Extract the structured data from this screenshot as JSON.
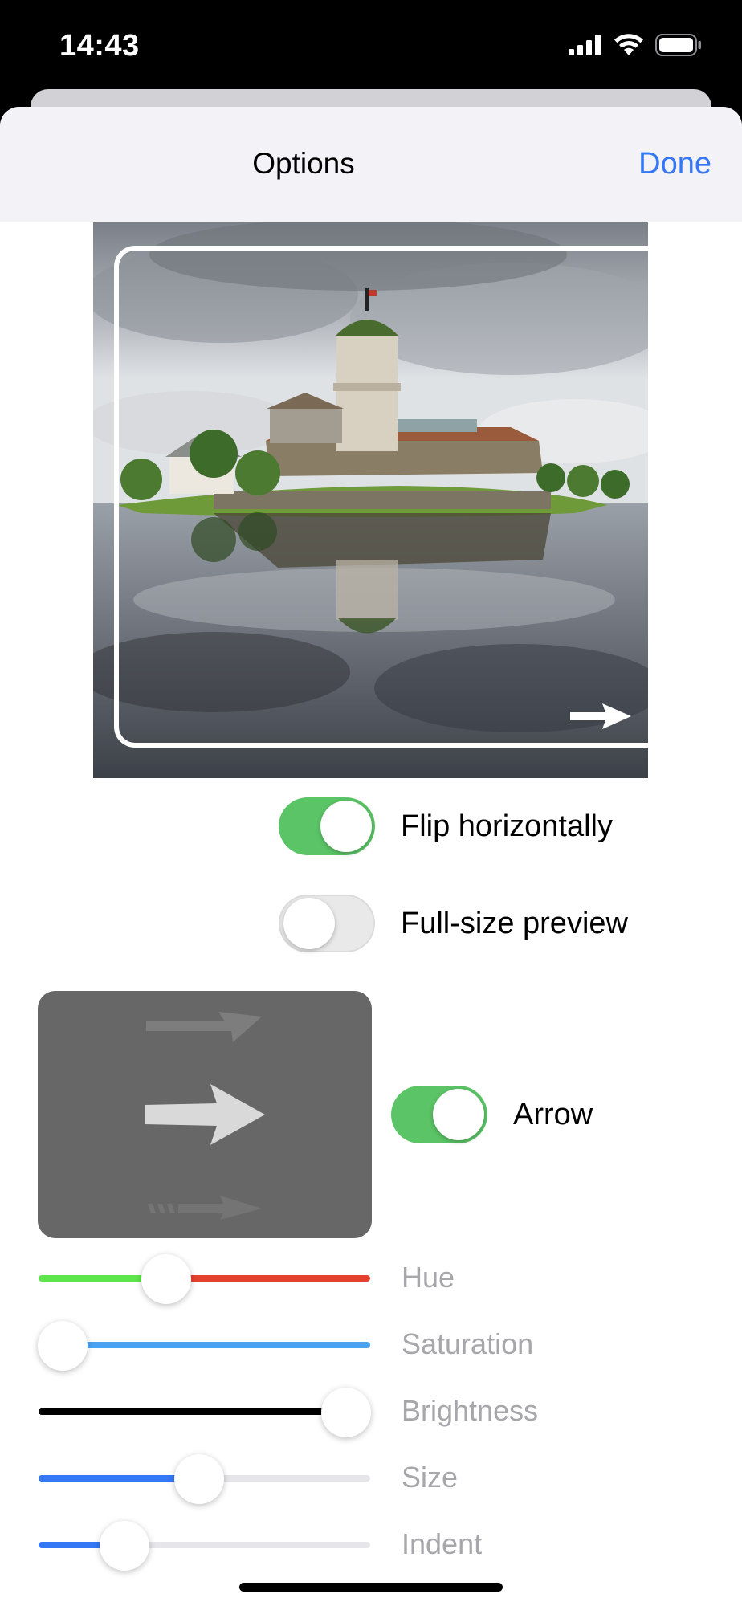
{
  "status": {
    "time": "14:43"
  },
  "nav": {
    "title": "Options",
    "done": "Done"
  },
  "toggles": {
    "flip": {
      "label": "Flip horizontally",
      "on": true
    },
    "fullsize": {
      "label": "Full-size preview",
      "on": false
    },
    "arrow": {
      "label": "Arrow",
      "on": true
    }
  },
  "sliders": [
    {
      "label": "Hue",
      "value": 0.37
    },
    {
      "label": "Saturation",
      "value": 0.0
    },
    {
      "label": "Brightness",
      "value": 0.93
    },
    {
      "label": "Size",
      "value": 0.48
    },
    {
      "label": "Indent",
      "value": 0.26
    }
  ],
  "colors": {
    "accent": "#3478f6",
    "toggle_on": "#5bc466",
    "hue_left": "#5ee54b",
    "hue_right": "#e5412f",
    "saturation": "#4aa3f0",
    "brightness": "#000000",
    "blue_fill": "#3478f6"
  }
}
